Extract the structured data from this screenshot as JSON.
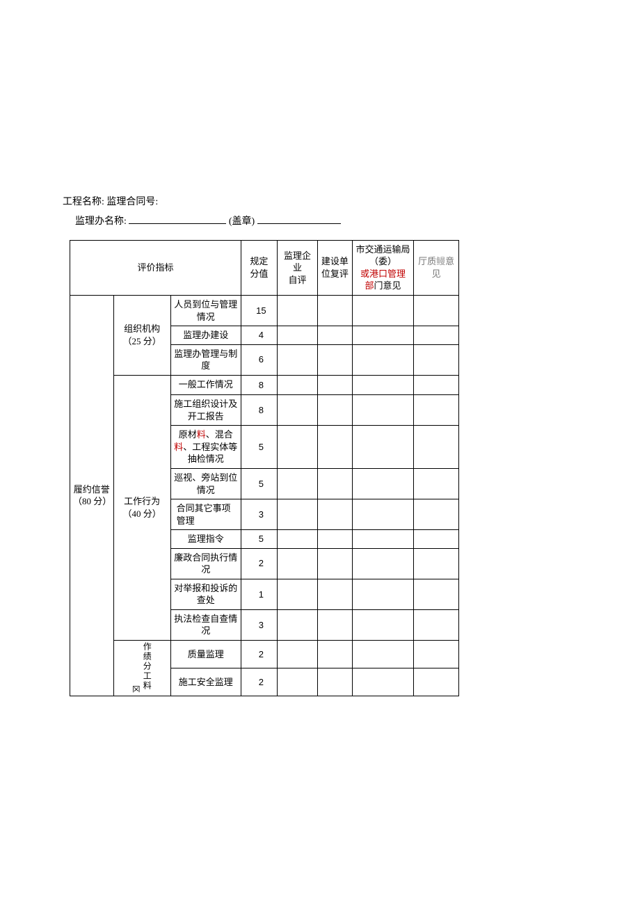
{
  "header": {
    "line1_label1": "工程名称:",
    "line1_label2": "监理合同号:",
    "line2_label": "监理办名称:",
    "seal_label": "(盖章)"
  },
  "columns": {
    "indicator": "评价指标",
    "fixed_score_a": "规定",
    "fixed_score_b": "分值",
    "self_a": "监理企业",
    "self_b": "自评",
    "review_a": "建设单",
    "review_b": "位复评",
    "bureau_a": "市交通运输局（委）",
    "bureau_b": "或港口管理",
    "bureau_c": "部",
    "bureau_d": "门意见",
    "hall_a": "厅质",
    "hall_b": "鳗",
    "hall_c": "意见"
  },
  "group_main": {
    "name_a": "履约信誉",
    "name_b": "（80 分）"
  },
  "sub1": {
    "name": "组织机构（25 分）",
    "items": [
      {
        "label": "人员到位与管理情况",
        "score": "15"
      },
      {
        "label": "监理办建设",
        "score": "4"
      },
      {
        "label": "监理办管理与制度",
        "score": "6"
      }
    ]
  },
  "sub2": {
    "name": "工作行为（40 分）",
    "items": [
      {
        "label": "一般工作情况",
        "score": "8"
      },
      {
        "label": "施工组织设计及开工报告",
        "score": "8"
      },
      {
        "label": "原材",
        "label_a": "料",
        "label_b": "、混合",
        "label_c": "料",
        "label_d": "、工程实体等抽检情况",
        "score": "5"
      },
      {
        "label": "巡视、旁站到位情况",
        "score": "5"
      },
      {
        "label": "合同其它事项管理",
        "score": "3"
      },
      {
        "label": "监理指令",
        "score": "5"
      },
      {
        "label": "廉政合同执行情况",
        "score": "2"
      },
      {
        "label": "对举报和投诉的查处",
        "score": "1"
      },
      {
        "label": "执法检查自查情况",
        "score": "3"
      }
    ]
  },
  "sub3": {
    "rotmark": "区",
    "vlabel": "作绩分工料",
    "items": [
      {
        "label": "质量监理",
        "score": "2"
      },
      {
        "label": "施工安全监理",
        "score": "2"
      }
    ]
  }
}
